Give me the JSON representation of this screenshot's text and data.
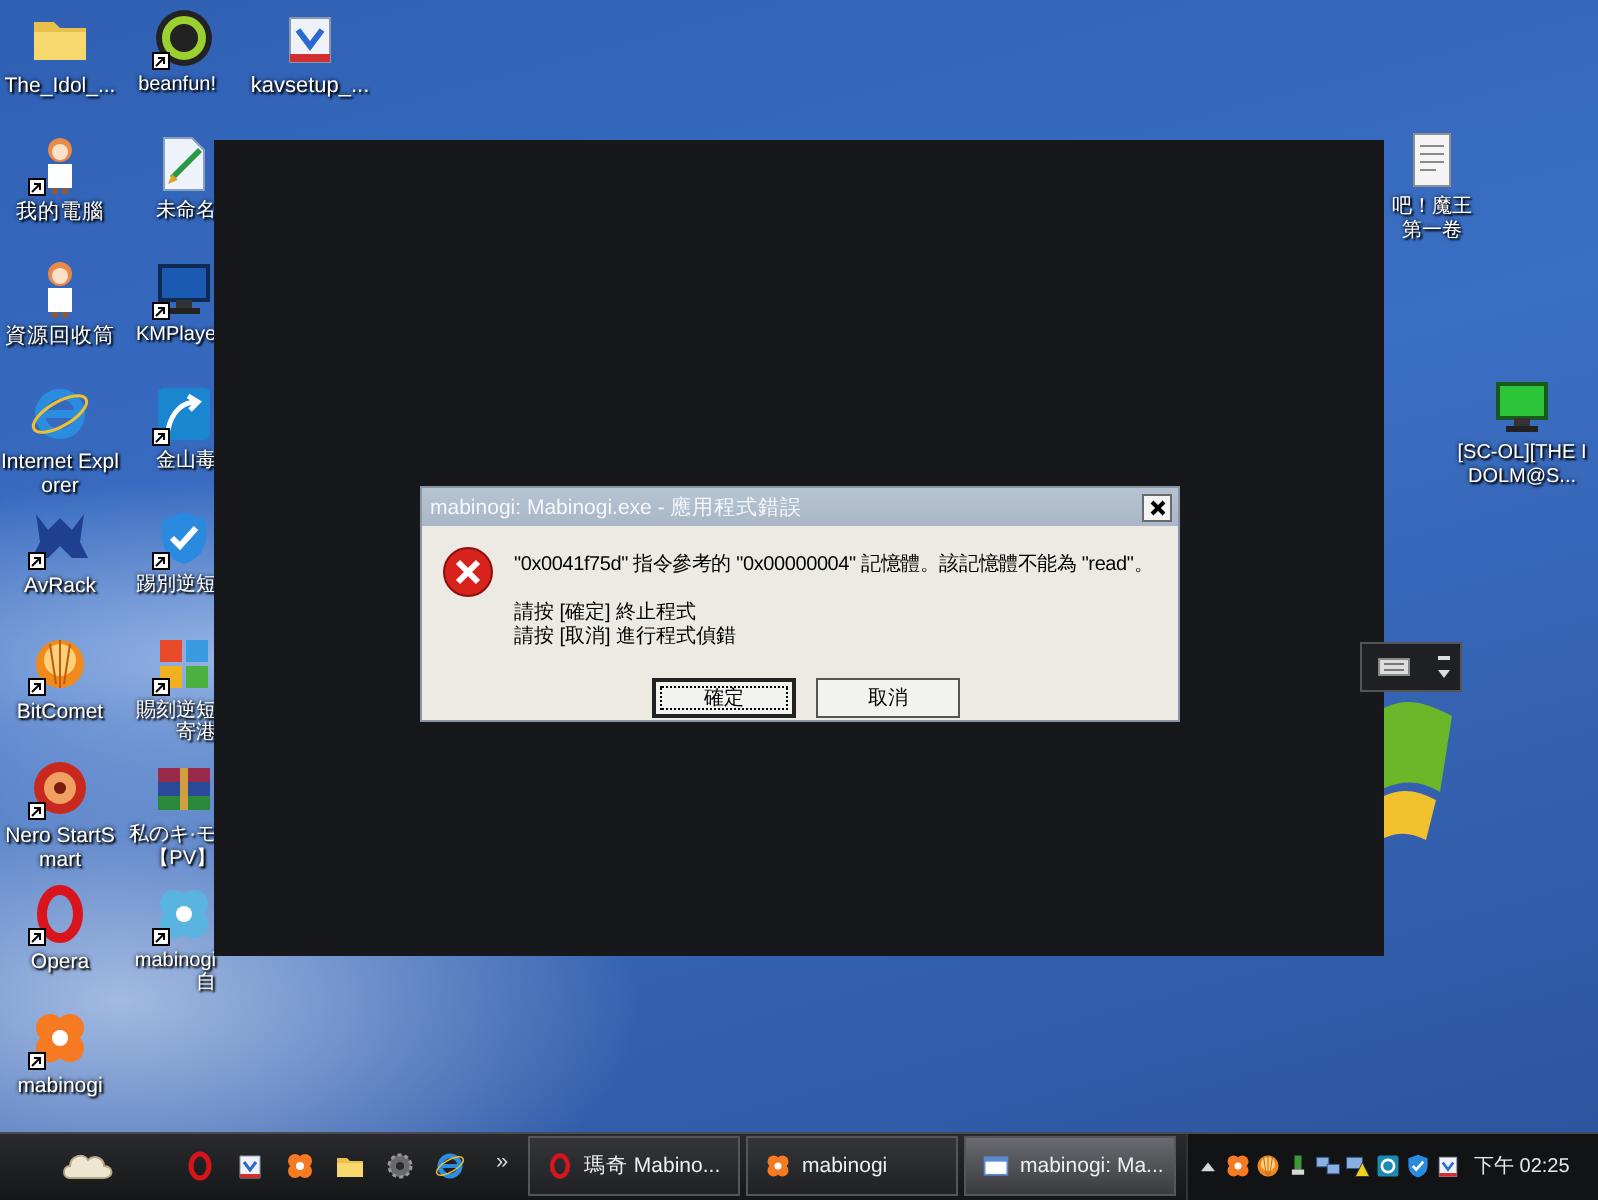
{
  "desktop": {
    "columns": [
      [
        {
          "label": "The_Idol_...",
          "kind": "folder",
          "shortcut": false
        },
        {
          "label": "我的電腦",
          "kind": "figure",
          "shortcut": true
        },
        {
          "label": "資源回收筒",
          "kind": "figure",
          "shortcut": false
        },
        {
          "label": "Internet Explorer",
          "kind": "globe",
          "shortcut": false
        },
        {
          "label": "AvRack",
          "kind": "emblem",
          "shortcut": true
        },
        {
          "label": "BitComet",
          "kind": "orangeball",
          "shortcut": true
        },
        {
          "label": "Nero StartSmart",
          "kind": "reddisc",
          "shortcut": true
        },
        {
          "label": "Opera",
          "kind": "redring",
          "shortcut": true
        },
        {
          "label": "mabinogi",
          "kind": "flower",
          "shortcut": true
        }
      ],
      [
        {
          "label": "beanfun!",
          "kind": "disc",
          "shortcut": true
        },
        {
          "label": "未命名",
          "kind": "brush",
          "shortcut": false
        },
        {
          "label": "KMPlaye",
          "kind": "monitor",
          "shortcut": true
        },
        {
          "label": "金山毒",
          "kind": "arrowtile",
          "shortcut": true
        },
        {
          "label": "踢別逆短",
          "kind": "shield",
          "shortcut": true
        },
        {
          "label": "賜刻逆短寄港",
          "kind": "tiles",
          "shortcut": true
        },
        {
          "label": "私のキ·モ【PV】",
          "kind": "books",
          "shortcut": false
        },
        {
          "label": "mabinogi自",
          "kind": "lace",
          "shortcut": true
        }
      ],
      [
        {
          "label": "kavsetup_...",
          "kind": "package",
          "shortcut": false
        }
      ]
    ],
    "right_icons": [
      {
        "label": "吧！魔王第一卷",
        "kind": "document",
        "shortcut": false
      },
      {
        "label": "[SC-OL][THE IDOLM@S...",
        "kind": "screen",
        "shortcut": false
      }
    ]
  },
  "dialog": {
    "title": "mabinogi: Mabinogi.exe - 應用程式錯誤",
    "message": "\"0x0041f75d\" 指令參考的 \"0x00000004\" 記憶體。該記憶體不能為 \"read\"。",
    "instructions": [
      "請按 [確定] 終止程式",
      "請按 [取消] 進行程式偵錯"
    ],
    "buttons": [
      {
        "label": "確定",
        "selected": true
      },
      {
        "label": "取消",
        "selected": false
      }
    ]
  },
  "taskbar": {
    "quick_launch": [
      {
        "kind": "redring"
      },
      {
        "kind": "package"
      },
      {
        "kind": "flower"
      },
      {
        "kind": "folder"
      },
      {
        "kind": "gear"
      },
      {
        "kind": "globe"
      }
    ],
    "overflow": "»",
    "tasks": [
      {
        "label": "瑪奇 Mabino...",
        "kind": "redring",
        "selected": false
      },
      {
        "label": "mabinogi",
        "kind": "flower",
        "selected": false
      },
      {
        "label": "mabinogi: Ma...",
        "kind": "window",
        "selected": true
      }
    ],
    "tray": [
      {
        "kind": "uparrow"
      },
      {
        "kind": "flower"
      },
      {
        "kind": "orangeball"
      },
      {
        "kind": "plug"
      },
      {
        "kind": "network"
      },
      {
        "kind": "warning"
      },
      {
        "kind": "app"
      },
      {
        "kind": "shield"
      },
      {
        "kind": "package"
      }
    ],
    "clock": "下午 02:25"
  }
}
